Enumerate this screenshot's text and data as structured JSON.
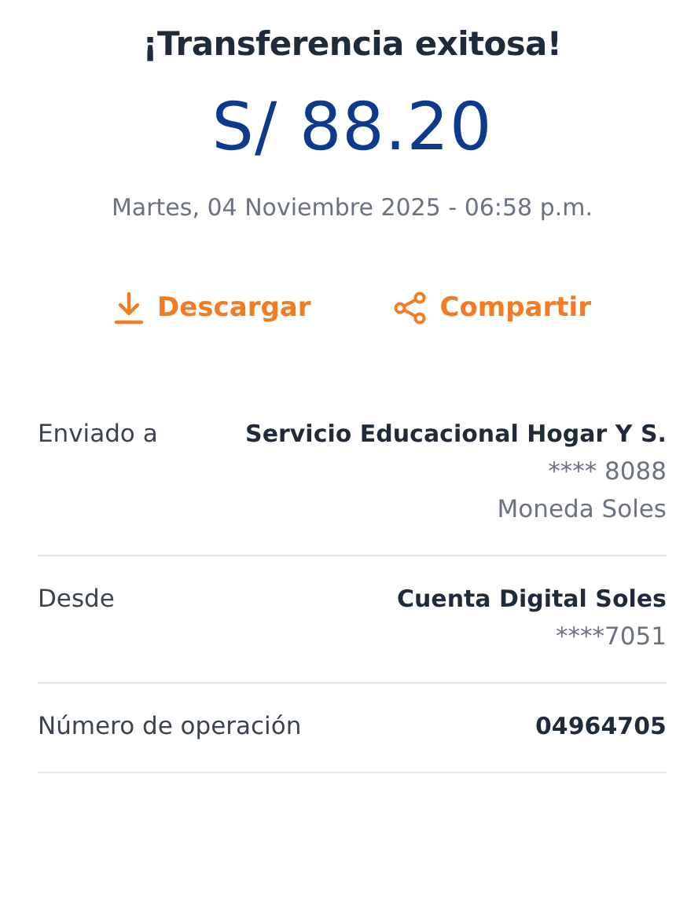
{
  "title": "¡Transferencia exitosa!",
  "amount": "S/ 88.20",
  "datetime": "Martes, 04 Noviembre 2025 - 06:58 p.m.",
  "actions": [
    {
      "label": "Descargar",
      "kind": "download"
    },
    {
      "label": "Compartir",
      "kind": "share"
    }
  ],
  "details": [
    {
      "label": "Enviado a",
      "values": [
        {
          "text": "Servicio Educacional Hogar Y S.",
          "kind": "primary"
        },
        {
          "text": "**** 8088",
          "kind": "secondary"
        },
        {
          "text": "Moneda Soles",
          "kind": "secondary"
        }
      ]
    },
    {
      "label": "Desde",
      "values": [
        {
          "text": "Cuenta Digital Soles",
          "kind": "primary"
        },
        {
          "text": "****7051",
          "kind": "secondary"
        }
      ]
    },
    {
      "label": "Número de operación",
      "values": [
        {
          "text": "04964705",
          "kind": "primary"
        }
      ]
    }
  ]
}
